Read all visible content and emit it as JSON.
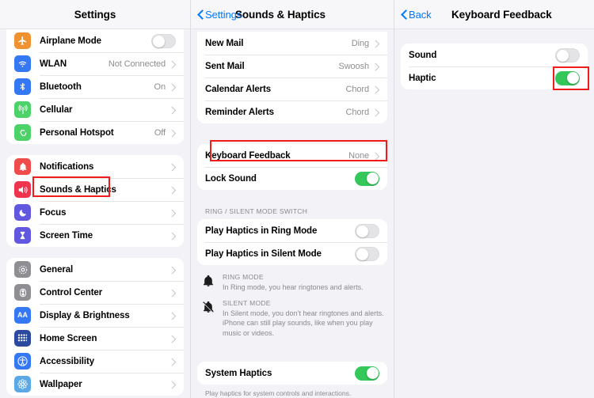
{
  "panels": {
    "left": {
      "nav": {
        "title": "Settings"
      },
      "groups": [
        {
          "rows": [
            {
              "label": "Airplane Mode",
              "icon": "airplane-icon",
              "color": "#f09232",
              "control": "toggle-off"
            },
            {
              "label": "WLAN",
              "icon": "wifi-icon",
              "color": "#3478f6",
              "value": "Not Connected",
              "control": "chevron"
            },
            {
              "label": "Bluetooth",
              "icon": "bluetooth-icon",
              "color": "#3478f6",
              "value": "On",
              "control": "chevron"
            },
            {
              "label": "Cellular",
              "icon": "cellular-icon",
              "color": "#4cd268",
              "value": "",
              "control": "chevron"
            },
            {
              "label": "Personal Hotspot",
              "icon": "hotspot-icon",
              "color": "#4cd268",
              "value": "Off",
              "control": "chevron"
            }
          ]
        },
        {
          "rows": [
            {
              "label": "Notifications",
              "icon": "notifications-bell-icon",
              "color": "#f04b4b",
              "control": "chevron"
            },
            {
              "label": "Sounds & Haptics",
              "icon": "speaker-icon",
              "color": "#f0344e",
              "control": "chevron"
            },
            {
              "label": "Focus",
              "icon": "moon-icon",
              "color": "#6258e0",
              "control": "chevron"
            },
            {
              "label": "Screen Time",
              "icon": "hourglass-icon",
              "color": "#6258e0",
              "control": "chevron"
            }
          ]
        },
        {
          "rows": [
            {
              "label": "General",
              "icon": "gear-icon",
              "color": "#8e8e93",
              "control": "chevron"
            },
            {
              "label": "Control Center",
              "icon": "sliders-icon",
              "color": "#8e8e93",
              "control": "chevron"
            },
            {
              "label": "Display & Brightness",
              "icon": "aa-text-icon",
              "color": "#3478f6",
              "control": "chevron"
            },
            {
              "label": "Home Screen",
              "icon": "grid-apps-icon",
              "color": "#2b4a9e",
              "control": "chevron"
            },
            {
              "label": "Accessibility",
              "icon": "accessibility-icon",
              "color": "#3478f6",
              "control": "chevron"
            },
            {
              "label": "Wallpaper",
              "icon": "flower-icon",
              "color": "#5aa9e6",
              "control": "chevron"
            }
          ]
        }
      ]
    },
    "middle": {
      "nav": {
        "back_label": "Settings",
        "title": "Sounds & Haptics"
      },
      "sounds_group": [
        {
          "label": "New Mail",
          "value": "Ding",
          "control": "chevron"
        },
        {
          "label": "Sent Mail",
          "value": "Swoosh",
          "control": "chevron"
        },
        {
          "label": "Calendar Alerts",
          "value": "Chord",
          "control": "chevron"
        },
        {
          "label": "Reminder Alerts",
          "value": "Chord",
          "control": "chevron"
        }
      ],
      "keyboard_group": [
        {
          "label": "Keyboard Feedback",
          "value": "None",
          "control": "chevron"
        },
        {
          "label": "Lock Sound",
          "control": "toggle-on"
        }
      ],
      "ring_section_header": "RING / SILENT MODE SWITCH",
      "ring_group": [
        {
          "label": "Play Haptics in Ring Mode",
          "control": "toggle-off"
        },
        {
          "label": "Play Haptics in Silent Mode",
          "control": "toggle-off"
        }
      ],
      "info": [
        {
          "icon": "bell-icon",
          "title": "RING MODE",
          "body": "In Ring mode, you hear ringtones and alerts."
        },
        {
          "icon": "bell-slash-icon",
          "title": "SILENT MODE",
          "body": "In Silent mode, you don’t hear ringtones and alerts. iPhone can still play sounds, like when you play music or videos."
        }
      ],
      "system_group": [
        {
          "label": "System Haptics",
          "control": "toggle-on"
        }
      ],
      "system_footer": "Play haptics for system controls and interactions."
    },
    "right": {
      "nav": {
        "back_label": "Back",
        "title": "Keyboard Feedback"
      },
      "group": [
        {
          "label": "Sound",
          "control": "toggle-off"
        },
        {
          "label": "Haptic",
          "control": "toggle-on"
        }
      ]
    }
  },
  "highlights": {
    "color": "#f01b1b",
    "items": [
      "Sounds & Haptics",
      "Keyboard Feedback",
      "Haptic toggle"
    ]
  }
}
